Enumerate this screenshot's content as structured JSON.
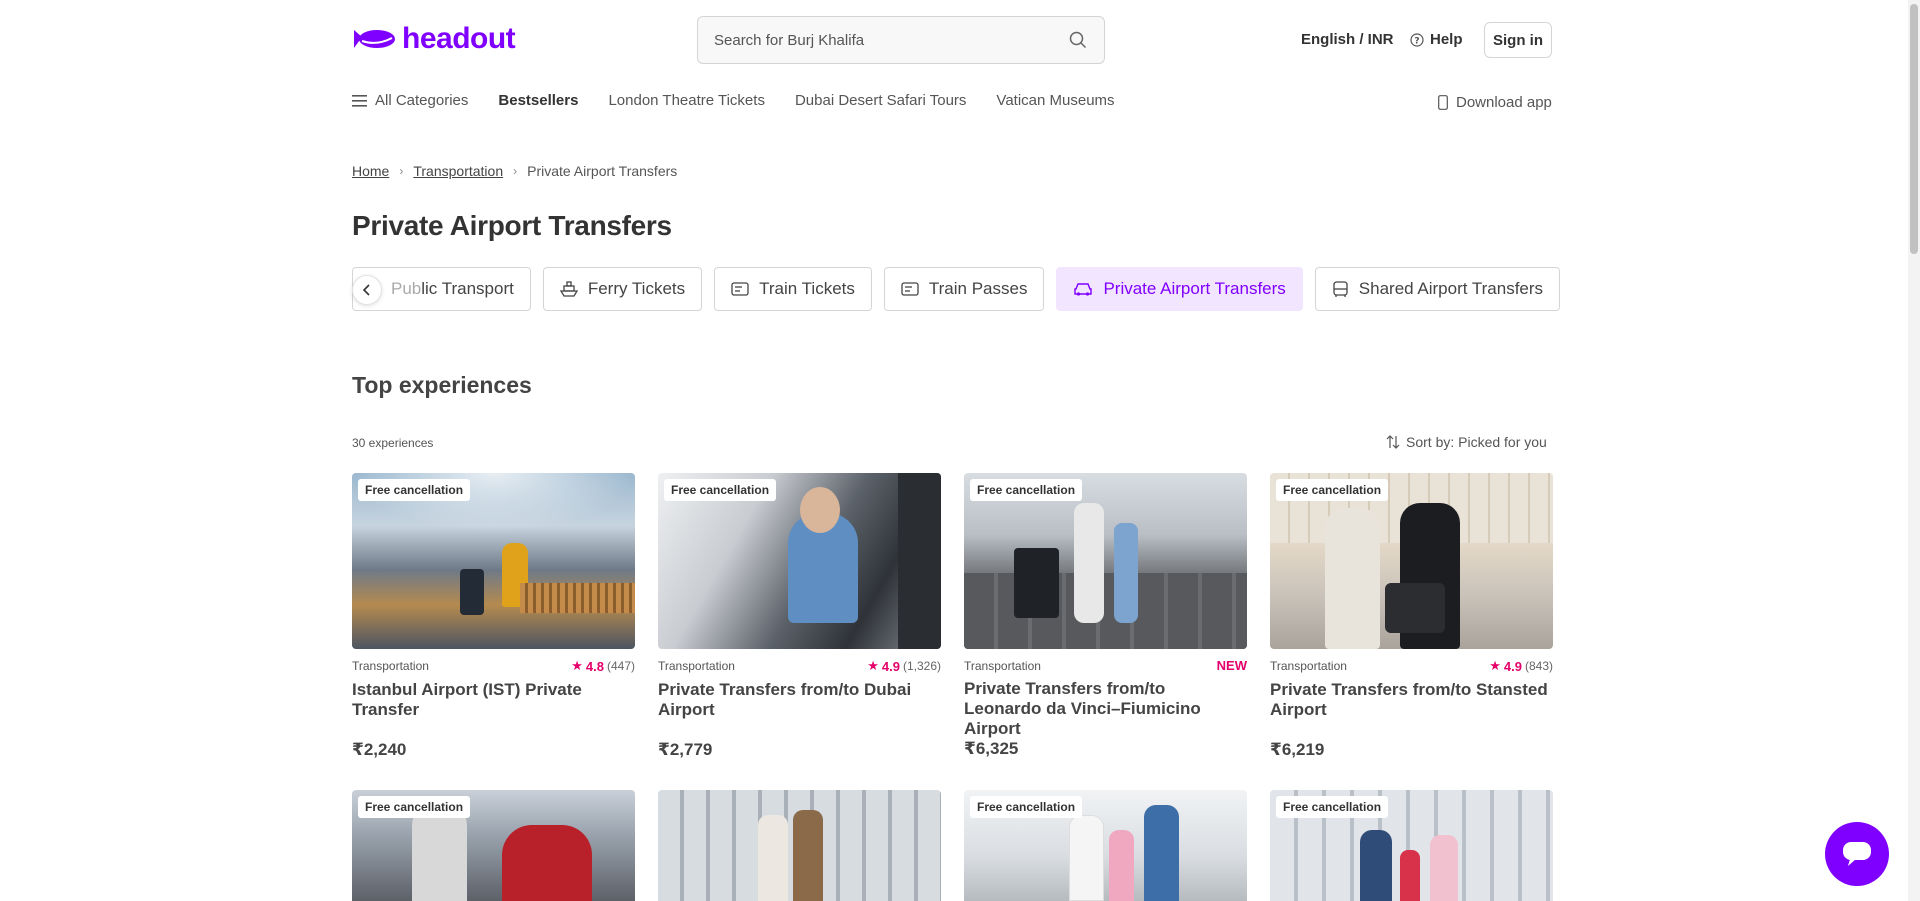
{
  "header": {
    "logo_text": "headout",
    "search_placeholder": "Search for Burj Khalifa",
    "language_currency": "English / INR",
    "help_label": "Help",
    "signin_label": "Sign in"
  },
  "nav": {
    "items": [
      {
        "label": "All Categories"
      },
      {
        "label": "Bestsellers"
      },
      {
        "label": "London Theatre Tickets"
      },
      {
        "label": "Dubai Desert Safari Tours"
      },
      {
        "label": "Vatican Museums"
      }
    ],
    "download_label": "Download app"
  },
  "breadcrumb": {
    "home": "Home",
    "transportation": "Transportation",
    "current": "Private Airport Transfers"
  },
  "page_title": "Private Airport Transfers",
  "chips": [
    {
      "label_fade": "Pub",
      "label": "lic Transport",
      "icon": "bus-icon"
    },
    {
      "label": "Ferry Tickets",
      "icon": "ferry-icon"
    },
    {
      "label": "Train Tickets",
      "icon": "ticket-icon"
    },
    {
      "label": "Train Passes",
      "icon": "ticket-icon"
    },
    {
      "label": "Private Airport Transfers",
      "icon": "car-icon",
      "active": true
    },
    {
      "label": "Shared Airport Transfers",
      "icon": "bus-icon"
    }
  ],
  "section_title": "Top experiences",
  "experience_count": "30 experiences",
  "sort_label": "Sort by: Picked for you",
  "cards": [
    {
      "badge": "Free cancellation",
      "category": "Transportation",
      "rating": "4.8",
      "reviews": "(447)",
      "title": "Istanbul Airport (IST) Private Transfer",
      "price": "₹2,240"
    },
    {
      "badge": "Free cancellation",
      "category": "Transportation",
      "rating": "4.9",
      "reviews": "(1,326)",
      "title": "Private Transfers from/to Dubai Airport",
      "price": "₹2,779"
    },
    {
      "badge": "Free cancellation",
      "category": "Transportation",
      "new_label": "NEW",
      "title": "Private Transfers from/to Leonardo da Vinci–Fiumicino Airport",
      "price": "₹6,325"
    },
    {
      "badge": "Free cancellation",
      "category": "Transportation",
      "rating": "4.9",
      "reviews": "(843)",
      "title": "Private Transfers from/to Stansted Airport",
      "price": "₹6,219"
    },
    {
      "badge": "Free cancellation"
    },
    {},
    {
      "badge": "Free cancellation"
    },
    {
      "badge": "Free cancellation"
    }
  ],
  "colors": {
    "brand": "#8000ff",
    "rating": "#e5006a",
    "active_chip_bg": "#f2e5ff"
  }
}
